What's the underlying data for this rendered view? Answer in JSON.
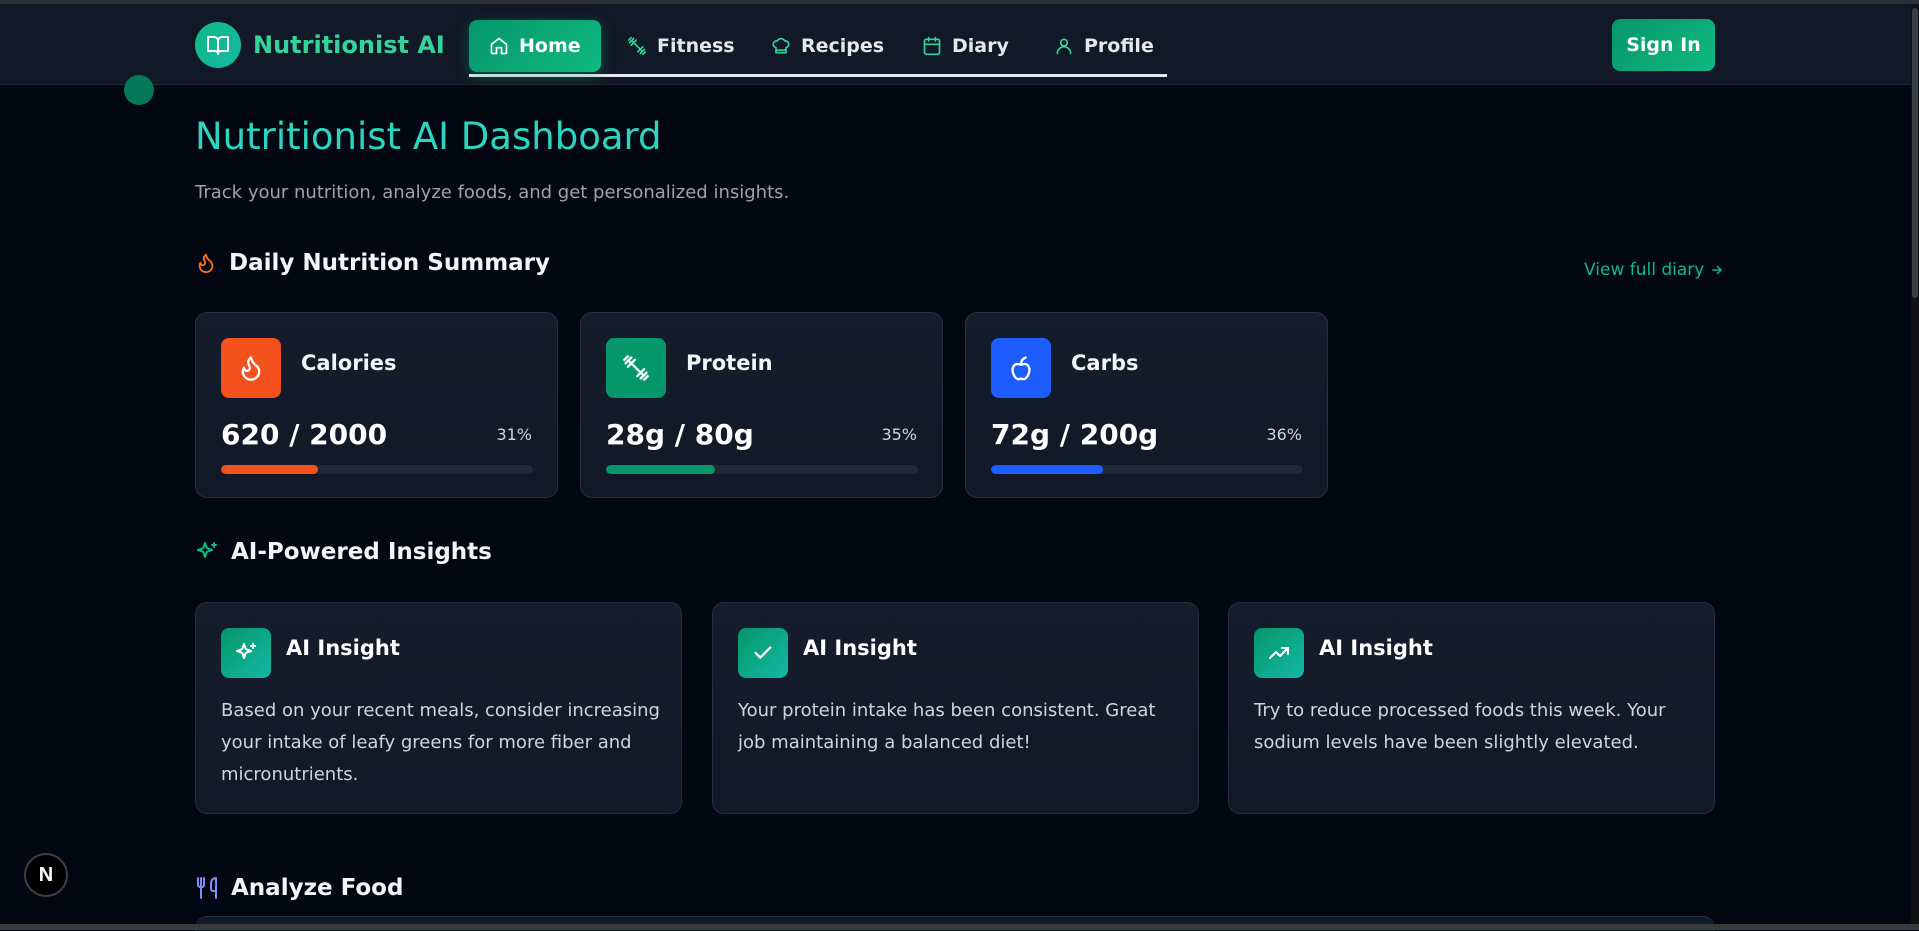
{
  "nav": {
    "brand": "Nutritionist AI",
    "links": [
      {
        "label": "Home",
        "icon": "home-icon",
        "active": true
      },
      {
        "label": "Fitness",
        "icon": "dumbbell-icon"
      },
      {
        "label": "Recipes",
        "icon": "chef-hat-icon"
      },
      {
        "label": "Diary",
        "icon": "calendar-icon"
      },
      {
        "label": "Profile",
        "icon": "user-icon"
      }
    ],
    "signin_label": "Sign In"
  },
  "page": {
    "title": "Nutritionist AI Dashboard",
    "subtitle": "Track your nutrition, analyze foods, and get personalized insights."
  },
  "summary": {
    "title": "Daily Nutrition Summary",
    "icon": "flame-icon",
    "view_link": "View full diary",
    "cards": [
      {
        "label": "Calories",
        "value": "620 / 2000",
        "percent": "31%",
        "fraction": 0.31,
        "color": "#f4511e",
        "icon": "flame-icon"
      },
      {
        "label": "Protein",
        "value": "28g / 80g",
        "percent": "35%",
        "fraction": 0.35,
        "color": "#059669",
        "icon": "dumbbell-icon"
      },
      {
        "label": "Carbs",
        "value": "72g / 200g",
        "percent": "36%",
        "fraction": 0.36,
        "color": "#1d5cff",
        "icon": "apple-icon"
      }
    ]
  },
  "insights": {
    "title": "AI-Powered Insights",
    "icon": "sparkles-icon",
    "cards": [
      {
        "title": "AI Insight",
        "icon": "sparkles-icon",
        "text": "Based on your recent meals, consider increasing your intake of leafy greens for more fiber and micronutrients."
      },
      {
        "title": "AI Insight",
        "icon": "check-icon",
        "text": "Your protein intake has been consistent. Great job maintaining a balanced diet!"
      },
      {
        "title": "AI Insight",
        "icon": "trending-up-icon",
        "text": "Try to reduce processed foods this week. Your sodium levels have been slightly elevated."
      }
    ]
  },
  "analyze": {
    "title": "Analyze Food",
    "icon": "utensils-icon"
  },
  "badge": {
    "letter": "N"
  },
  "colors": {
    "accent": "#10b981",
    "title": "#2dd4bf",
    "background": "#030712",
    "card": "#111827"
  }
}
